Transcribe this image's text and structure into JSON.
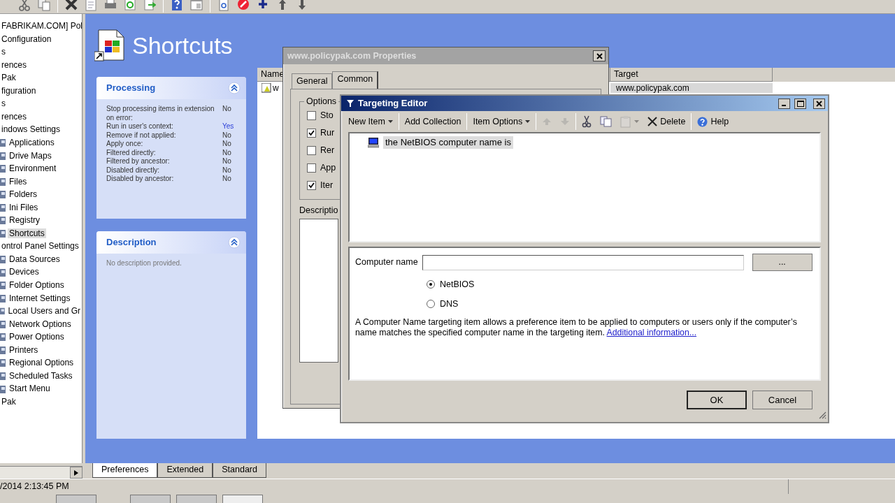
{
  "tree": [
    {
      "label": "FABRIKAM.COM] Pol",
      "selected": false
    },
    {
      "label": "Configuration",
      "selected": false
    },
    {
      "label": "s",
      "selected": false
    },
    {
      "label": "rences",
      "selected": false
    },
    {
      "label": "Pak",
      "selected": false
    },
    {
      "label": "figuration",
      "selected": false
    },
    {
      "label": "s",
      "selected": false
    },
    {
      "label": "rences",
      "selected": false
    },
    {
      "label": "indows Settings",
      "selected": false,
      "children": [
        {
          "label": "Applications",
          "selected": false
        },
        {
          "label": "Drive Maps",
          "selected": false
        },
        {
          "label": "Environment",
          "selected": false
        },
        {
          "label": "Files",
          "selected": false
        },
        {
          "label": "Folders",
          "selected": false
        },
        {
          "label": "Ini Files",
          "selected": false
        },
        {
          "label": "Registry",
          "selected": false
        },
        {
          "label": "Shortcuts",
          "selected": true
        }
      ]
    },
    {
      "label": "ontrol Panel Settings",
      "selected": false,
      "children": [
        {
          "label": "Data Sources",
          "selected": false
        },
        {
          "label": "Devices",
          "selected": false
        },
        {
          "label": "Folder Options",
          "selected": false
        },
        {
          "label": "Internet Settings",
          "selected": false
        },
        {
          "label": "Local Users and Gr",
          "selected": false
        },
        {
          "label": "Network Options",
          "selected": false
        },
        {
          "label": "Power Options",
          "selected": false
        },
        {
          "label": "Printers",
          "selected": false
        },
        {
          "label": "Regional Options",
          "selected": false
        },
        {
          "label": "Scheduled Tasks",
          "selected": false
        },
        {
          "label": "Start Menu",
          "selected": false
        }
      ]
    },
    {
      "label": "Pak",
      "selected": false
    }
  ],
  "main": {
    "title": "Shortcuts",
    "processing": {
      "title": "Processing",
      "rows": [
        {
          "label": "Stop processing items in extension on error:",
          "value": "No",
          "highlighted": false
        },
        {
          "label": "Run in user's context:",
          "value": "Yes",
          "highlighted": true
        },
        {
          "label": "Remove if not applied:",
          "value": "No",
          "highlighted": false
        },
        {
          "label": "Apply once:",
          "value": "No",
          "highlighted": false
        },
        {
          "label": "Filtered directly:",
          "value": "No",
          "highlighted": false
        },
        {
          "label": "Filtered by ancestor:",
          "value": "No",
          "highlighted": false
        },
        {
          "label": "Disabled directly:",
          "value": "No",
          "highlighted": false
        },
        {
          "label": "Disabled by ancestor:",
          "value": "No",
          "highlighted": false
        }
      ]
    },
    "description": {
      "title": "Description",
      "text": "No description provided."
    },
    "list": {
      "columns": [
        "Name",
        "Target"
      ],
      "rows": [
        {
          "name": "w",
          "target": "www.policypak.com"
        }
      ]
    }
  },
  "bottom_tabs": [
    {
      "label": "Preferences",
      "selected": true
    },
    {
      "label": "Extended",
      "selected": false
    },
    {
      "label": "Standard",
      "selected": false
    }
  ],
  "status_bar": {
    "text": "/2014 2:13:45 PM"
  },
  "properties_dialog": {
    "title": "www.policypak.com Properties",
    "tabs": [
      {
        "label": "General",
        "selected": false
      },
      {
        "label": "Common",
        "selected": true
      }
    ],
    "options_title": "Options",
    "options": [
      {
        "label": "Sto",
        "checked": false
      },
      {
        "label": "Rur",
        "checked": true
      },
      {
        "label": "Rer",
        "checked": false
      },
      {
        "label": "App",
        "checked": false
      },
      {
        "label": "Iter",
        "checked": true
      }
    ],
    "description_label": "Descriptio"
  },
  "targeting_editor": {
    "title": "Targeting Editor",
    "toolbar": [
      {
        "kind": "menu",
        "label": "New Item",
        "disabled": false
      },
      {
        "kind": "button",
        "label": "Add Collection",
        "disabled": false
      },
      {
        "kind": "menu",
        "label": "Item Options",
        "disabled": false
      },
      {
        "kind": "up",
        "disabled": true
      },
      {
        "kind": "down",
        "disabled": true
      },
      {
        "kind": "cut",
        "disabled": false
      },
      {
        "kind": "copy",
        "disabled": false
      },
      {
        "kind": "paste",
        "disabled": true
      },
      {
        "kind": "delete",
        "label": "Delete",
        "disabled": false
      },
      {
        "kind": "help",
        "label": "Help",
        "disabled": false
      }
    ],
    "items": [
      {
        "label": "the NetBIOS computer name is",
        "selected": true
      }
    ],
    "form": {
      "label": "Computer name",
      "browse": "...",
      "radios": [
        {
          "label": "NetBIOS",
          "selected": true
        },
        {
          "label": "DNS",
          "selected": false
        }
      ],
      "help": "A Computer Name targeting item allows a preference item to be applied to computers or users only if the computer’s name matches the specified computer name in the targeting item.",
      "link": "Additional information..."
    },
    "buttons": [
      {
        "label": "OK",
        "default": true
      },
      {
        "label": "Cancel",
        "default": false
      }
    ]
  }
}
